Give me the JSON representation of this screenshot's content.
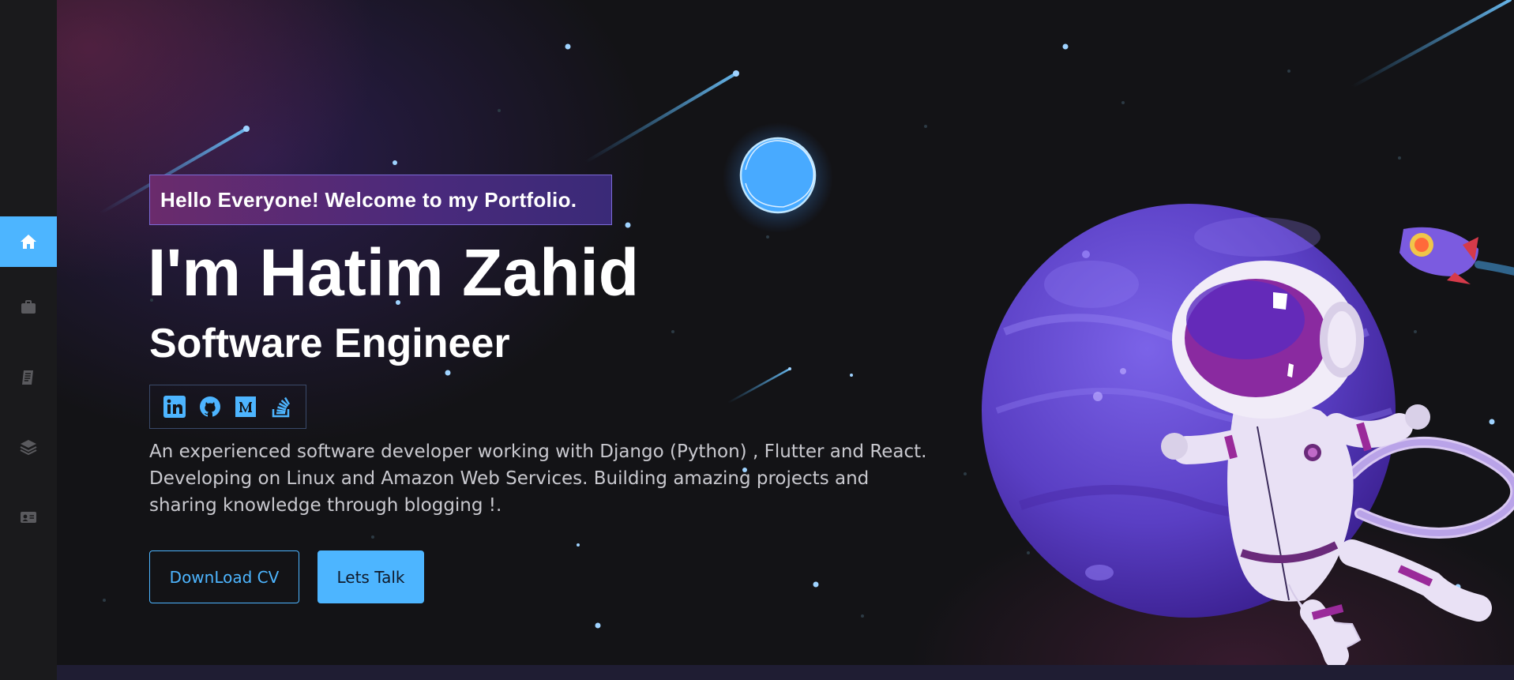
{
  "sidebar": {
    "items": [
      {
        "icon": "home-icon",
        "active": true
      },
      {
        "icon": "briefcase-icon",
        "active": false
      },
      {
        "icon": "blog-icon",
        "active": false
      },
      {
        "icon": "layers-icon",
        "active": false
      },
      {
        "icon": "contact-card-icon",
        "active": false
      }
    ],
    "colors": {
      "active": "#4db5ff",
      "inactive_icon": "#5a5a5e"
    }
  },
  "hero": {
    "welcome": "Hello Everyone! Welcome to my Portfolio.",
    "name": "I'm Hatim Zahid",
    "role": "Software Engineer",
    "social": [
      {
        "icon": "linkedin-icon"
      },
      {
        "icon": "github-icon"
      },
      {
        "icon": "medium-icon"
      },
      {
        "icon": "stackoverflow-icon"
      }
    ],
    "description": "An experienced software developer working with Django (Python) , Flutter and React. Developing on Linux and Amazon Web Services. Building amazing projects and sharing knowledge through blogging !.",
    "buttons": {
      "download_cv": "DownLoad CV",
      "lets_talk": "Lets Talk"
    }
  },
  "theme": {
    "accent": "#4db5ff",
    "background": "#131316",
    "planet": "#6a4bd6"
  }
}
